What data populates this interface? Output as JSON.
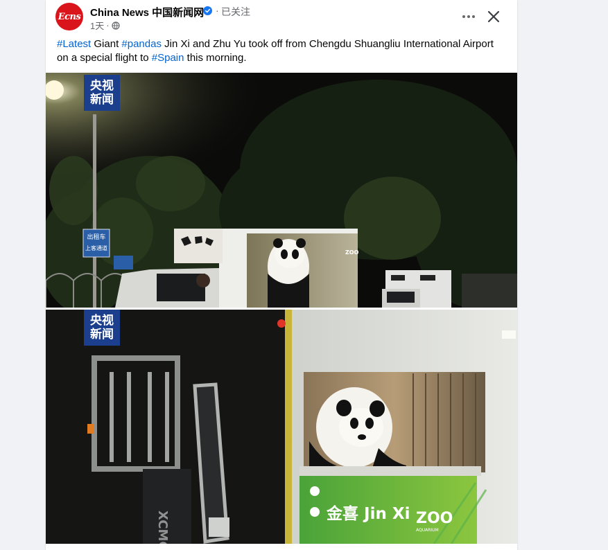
{
  "post": {
    "page_name": "China News 中国新闻网",
    "follow_status": "已关注",
    "separator": "·",
    "time_ago": "1天",
    "avatar_text": "Ecns",
    "caption": {
      "tag1": "#Latest",
      "text1": " Giant ",
      "tag2": "#pandas",
      "text2": " Jin Xi and Zhu Yu took off from Chengdu Shuangliu International Airport on a special flight to ",
      "tag3": "#Spain",
      "text3": " this morning."
    }
  },
  "photos": {
    "watermark_line1": "央视",
    "watermark_line2": "新闻",
    "sign_text_line1": "出租车",
    "sign_text_line2": "上客通道",
    "crate_sign": "金喜 Jin Xi",
    "zoo_logo": "ZOO",
    "zoo_sub": "AQUARIUM",
    "truck_brand": "ZOO",
    "forklift_brand": "XCMG"
  },
  "icons": {
    "globe": "globe-icon",
    "more": "more-icon",
    "close": "close-icon",
    "verified": "verified-badge-icon"
  },
  "colors": {
    "link": "#0064d1",
    "verified": "#1877f2",
    "avatar_bg": "#d9141b",
    "cctv_bg": "#1b3f8c",
    "crate_sign_bg": "#8cc63f"
  }
}
